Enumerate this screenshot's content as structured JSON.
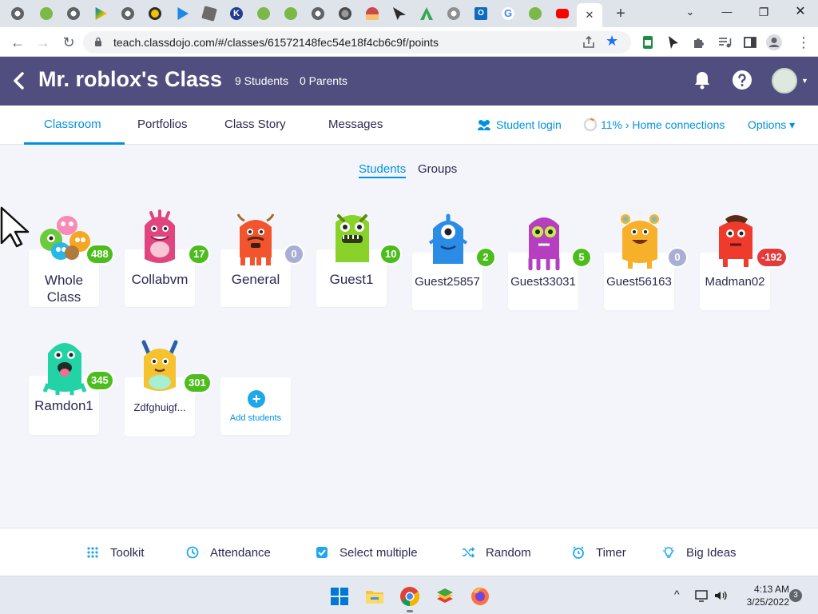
{
  "browser": {
    "tabs": [
      {
        "icon": "chrome-icon",
        "color": "#5f6368"
      },
      {
        "icon": "monster-favicon",
        "color": "#7ab848"
      },
      {
        "icon": "chrome-icon",
        "color": "#5f6368"
      },
      {
        "icon": "play-store-icon",
        "color": "#1a73e8"
      },
      {
        "icon": "chrome-icon",
        "color": "#5f6368"
      },
      {
        "icon": "yellow-circle-icon",
        "color": "#f2c200"
      },
      {
        "icon": "play-icon",
        "color": "#1e88e5"
      },
      {
        "icon": "roblox-icon",
        "color": "#6b6b6b"
      },
      {
        "icon": "k-icon",
        "color": "#223c92"
      },
      {
        "icon": "monster-favicon",
        "color": "#7ab848"
      },
      {
        "icon": "monster-favicon",
        "color": "#7ab848"
      },
      {
        "icon": "chrome-icon",
        "color": "#5f6368"
      },
      {
        "icon": "round-gray-icon",
        "color": "#4b4b4b"
      },
      {
        "icon": "hat-icon",
        "color": "#c94a4a"
      },
      {
        "icon": "cursor-favicon",
        "color": "#2b2b2b"
      },
      {
        "icon": "green-a-icon",
        "color": "#34a853"
      },
      {
        "icon": "chrome-icon",
        "color": "#8f8f8f"
      },
      {
        "icon": "outlook-icon",
        "color": "#0f6cbd"
      },
      {
        "icon": "google-icon",
        "color": "#4285f4"
      },
      {
        "icon": "monster-favicon",
        "color": "#7ab848"
      },
      {
        "icon": "youtube-icon",
        "color": "#ff0000"
      },
      {
        "icon": "close-icon",
        "color": "#3c4043"
      }
    ],
    "new_tab": "+",
    "window_controls": {
      "minimize": "—",
      "maximize": "❐",
      "close": "✕",
      "tablist": "⌄"
    },
    "url": "teach.classdojo.com/#/classes/61572148fec54e18f4cb6c9f/points"
  },
  "header": {
    "title": "Mr. roblox's Class",
    "students_count": "9 Students",
    "parents_count": "0 Parents"
  },
  "tabs": {
    "classroom": "Classroom",
    "portfolios": "Portfolios",
    "class_story": "Class Story",
    "messages": "Messages",
    "student_login": "Student login",
    "home_connections": "11% › Home connections",
    "options": "Options ▾"
  },
  "view_toggle": {
    "students": "Students",
    "groups": "Groups"
  },
  "students": [
    {
      "name_line1": "Whole",
      "name_line2": "Class",
      "points": "488",
      "badge": "pos",
      "monster": "whole-class"
    },
    {
      "name": "Collabvm",
      "points": "17",
      "badge": "pos",
      "monster": "pink",
      "color": "#e0457f"
    },
    {
      "name": "General",
      "points": "0",
      "badge": "zero",
      "monster": "orange",
      "color": "#f2542d"
    },
    {
      "name": "Guest1",
      "points": "10",
      "badge": "pos",
      "monster": "green",
      "color": "#88d22a"
    },
    {
      "name": "Guest25857",
      "points": "2",
      "badge": "pos",
      "monster": "blue",
      "color": "#2b8ce6"
    },
    {
      "name": "Guest33031",
      "points": "5",
      "badge": "pos",
      "monster": "purple",
      "color": "#b63fc0"
    },
    {
      "name": "Guest56163",
      "points": "0",
      "badge": "zero",
      "monster": "yellow",
      "color": "#f7b02a"
    },
    {
      "name": "Madman02",
      "points": "-192",
      "badge": "neg",
      "monster": "red",
      "color": "#ef3b2c"
    },
    {
      "name": "Ramdon1",
      "points": "345",
      "badge": "pos",
      "monster": "teal",
      "color": "#22d3a6"
    },
    {
      "name": "Zdfghuigf...",
      "points": "301",
      "badge": "pos",
      "monster": "yellow-horns",
      "color": "#f6c330"
    }
  ],
  "add_students": "Add students",
  "toolbar": {
    "toolkit": "Toolkit",
    "attendance": "Attendance",
    "select_multiple": "Select multiple",
    "random": "Random",
    "timer": "Timer",
    "big_ideas": "Big Ideas"
  },
  "taskbar": {
    "apps": [
      "windows-start-icon",
      "file-explorer-icon",
      "chrome-icon",
      "bluestacks-icon",
      "firefox-icon"
    ],
    "tray_caret": "^",
    "time": "4:13 AM",
    "date": "3/25/2022",
    "notification_count": "3"
  },
  "colors": {
    "header_bg": "#4f4e7e",
    "accent_blue": "#0092e0",
    "badge_green": "#4dbd1e",
    "badge_gray": "#a9aed4",
    "badge_red": "#e33b3b"
  }
}
